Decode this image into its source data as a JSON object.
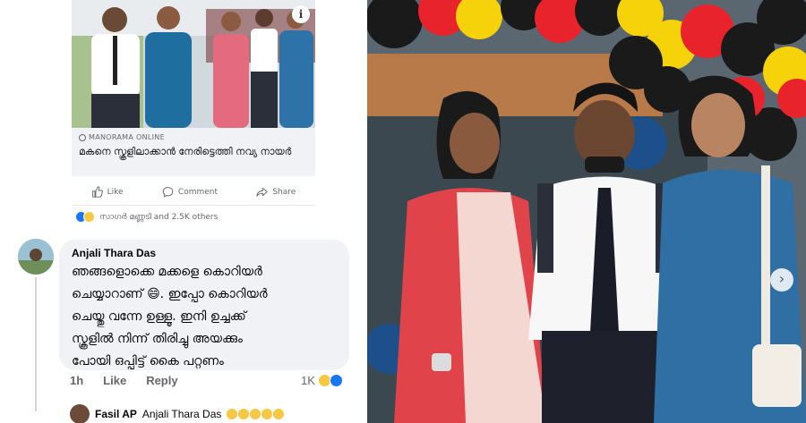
{
  "post": {
    "info_icon": "i",
    "link_source": "MANORAMA ONLINE",
    "link_title": "മകനെ സ്കൂളിലാക്കാൻ നേരിട്ടെത്തി നവ്യ നായർ",
    "actions": {
      "like": "Like",
      "comment": "Comment",
      "share": "Share"
    },
    "reactions_text": "സാഗർ മണ്ണടി and 2.5K others"
  },
  "comment": {
    "author": "Anjali Thara Das",
    "text": "ഞങ്ങളൊക്കെ മക്കളെ കൊറിയർ\nചെയ്യാറാണ് 😄. ഇപ്പോ കൊറിയർ\nചെയ്തു വന്നേ ഉള്ളൂ. ഇനി ഉച്ചക്ക്\nസ്കൂളിൽ നിന്ന് തിരിച്ചു അയക്കും\nപോയി ഒപ്പിട്ട് കൈ പറ്റണം",
    "time": "1h",
    "like_label": "Like",
    "reply_label": "Reply",
    "reaction_count": "1K"
  },
  "reply": {
    "author": "Fasil AP",
    "mention": "Anjali Thara Das"
  },
  "icons": {
    "info": "info-icon",
    "like": "thumbs-up-icon",
    "comment": "speech-bubble-icon",
    "share": "share-arrow-icon",
    "next": "chevron-right-icon"
  },
  "colors": {
    "fb_blue": "#1877f2",
    "bubble_bg": "#f0f2f5",
    "meta_gray": "#65676b",
    "balloon_red": "#e8232b",
    "balloon_yellow": "#f5d20a",
    "balloon_black": "#1a1a1a"
  }
}
